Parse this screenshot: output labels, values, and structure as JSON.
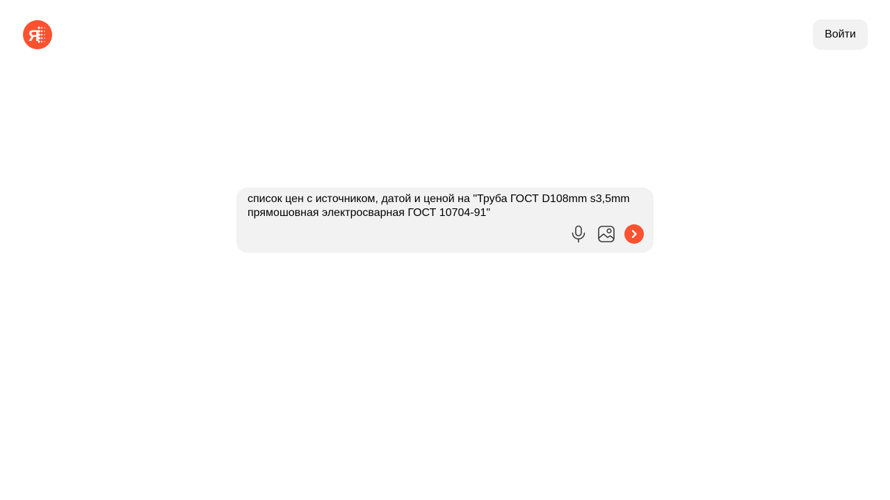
{
  "header": {
    "logo_icon": "yandex-alice-logo-icon",
    "logo_letter": "Я",
    "login_label": "Войти"
  },
  "search": {
    "query": "список цен с источником, датой и ценой на \"Труба ГОСТ D108mm s3,5mm прямошовная электросварная ГОСТ 10704-91\"",
    "mic_icon": "microphone-icon",
    "image_icon": "image-search-icon",
    "submit_icon": "chevron-right-icon"
  },
  "colors": {
    "accent": "#fc5230",
    "surface": "#f2f2f2",
    "background": "#ffffff",
    "text": "#000000"
  }
}
